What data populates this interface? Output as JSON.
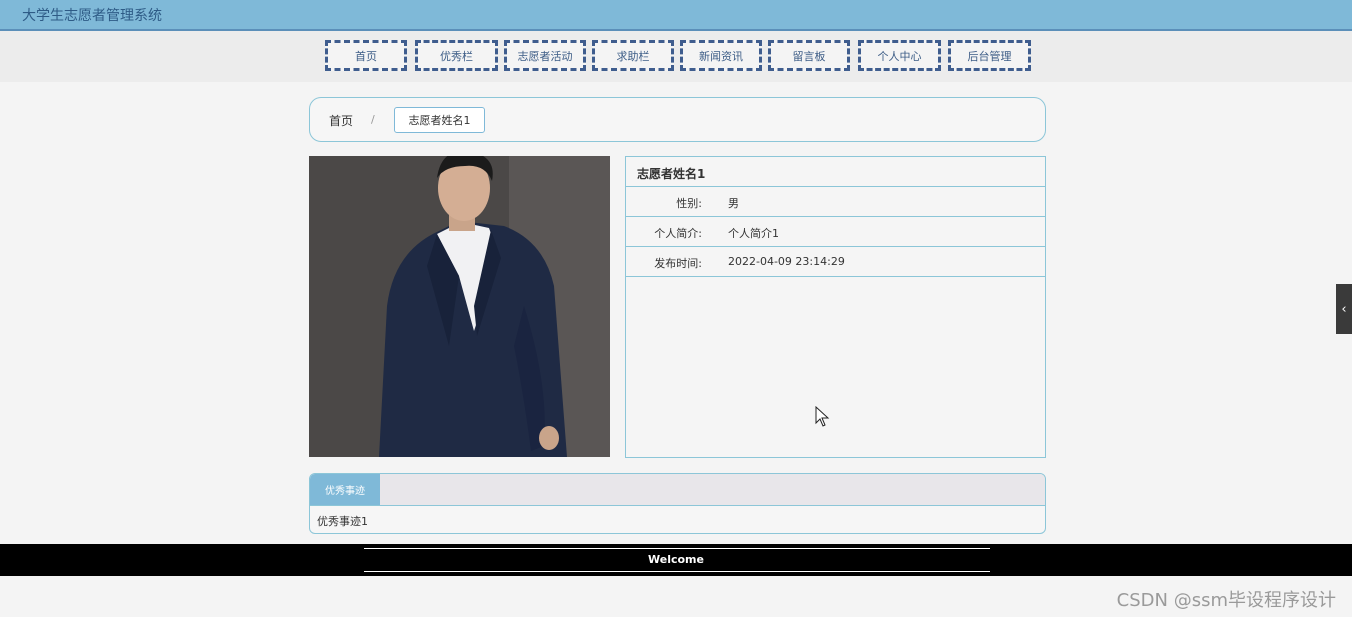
{
  "app": {
    "title": "大学生志愿者管理系统"
  },
  "nav": {
    "items": [
      "首页",
      "优秀栏",
      "志愿者活动",
      "求助栏",
      "新闻资讯",
      "留言板",
      "个人中心",
      "后台管理"
    ]
  },
  "breadcrumb": {
    "home": "首页",
    "separator": "/",
    "current": "志愿者姓名1"
  },
  "detail": {
    "name": "志愿者姓名1",
    "fields": [
      {
        "label": "性别:",
        "value": "男"
      },
      {
        "label": "个人简介:",
        "value": "个人简介1"
      },
      {
        "label": "发布时间:",
        "value": "2022-04-09 23:14:29"
      }
    ]
  },
  "tabs": {
    "active": "优秀事迹",
    "content": "优秀事迹1"
  },
  "footer": {
    "text": "Welcome"
  },
  "side_toggle": {
    "icon": "chevron-left-icon",
    "glyph": "‹"
  },
  "watermark": "CSDN @ssm毕设程序设计",
  "colors": {
    "accent": "#7fb9d8",
    "nav_border": "#3f5d8e",
    "footer": "#000000"
  }
}
